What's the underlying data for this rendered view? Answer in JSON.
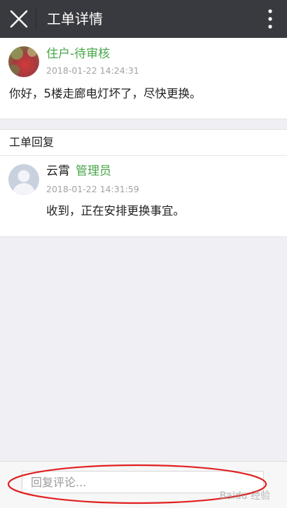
{
  "header": {
    "title": "工单详情",
    "close_icon": "close-icon",
    "more_icon": "more-vertical-icon"
  },
  "post": {
    "author": "住户-待审核",
    "time": "2018-01-22 14:24:31",
    "content": "你好，5楼走廊电灯坏了，尽快更换。"
  },
  "replies": {
    "section_title": "工单回复",
    "items": [
      {
        "author": "云霄",
        "role": "管理员",
        "time": "2018-01-22 14:31:59",
        "content": "收到，正在安排更换事宜。"
      }
    ]
  },
  "comment": {
    "placeholder": "回复评论...",
    "value": ""
  },
  "watermark": "Baidu 经验",
  "colors": {
    "titlebar": "#393a3f",
    "accent_green": "#48a548",
    "annotation_red": "#e02020"
  }
}
